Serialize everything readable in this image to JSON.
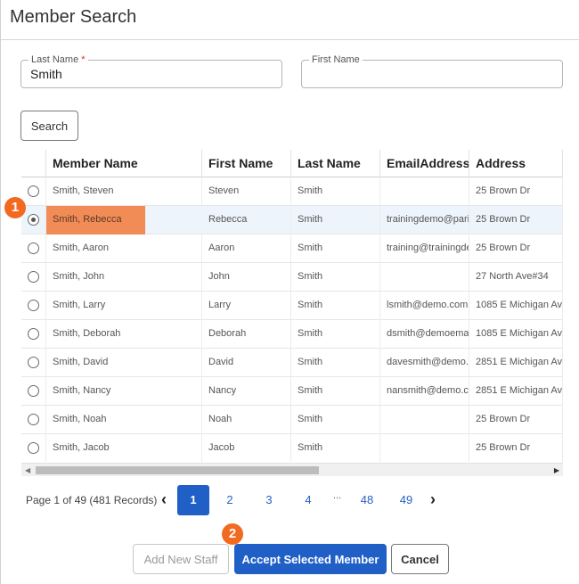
{
  "dialog": {
    "title": "Member Search"
  },
  "form": {
    "last_name": {
      "label": "Last Name",
      "required_mark": "*",
      "value": "Smith"
    },
    "first_name": {
      "label": "First Name",
      "value": ""
    },
    "search_label": "Search"
  },
  "table": {
    "columns": [
      "Member Name",
      "First Name",
      "Last Name",
      "EmailAddress",
      "Address"
    ],
    "selected_index": 1,
    "rows": [
      {
        "member_name": "Smith, Steven",
        "first": "Steven",
        "last": "Smith",
        "email": "",
        "address": "25 Brown Dr"
      },
      {
        "member_name": "Smith, Rebecca",
        "first": "Rebecca",
        "last": "Smith",
        "email": "trainingdemo@paris",
        "address": "25 Brown Dr"
      },
      {
        "member_name": "Smith, Aaron",
        "first": "Aaron",
        "last": "Smith",
        "email": "training@trainingde",
        "address": "25 Brown Dr"
      },
      {
        "member_name": "Smith, John",
        "first": "John",
        "last": "Smith",
        "email": "",
        "address": "27 North Ave#34"
      },
      {
        "member_name": "Smith, Larry",
        "first": "Larry",
        "last": "Smith",
        "email": "lsmith@demo.com",
        "address": "1085 E Michigan Av"
      },
      {
        "member_name": "Smith, Deborah",
        "first": "Deborah",
        "last": "Smith",
        "email": "dsmith@demoemai",
        "address": "1085 E Michigan Av"
      },
      {
        "member_name": "Smith, David",
        "first": "David",
        "last": "Smith",
        "email": "davesmith@demo.c",
        "address": "2851 E Michigan Av"
      },
      {
        "member_name": "Smith, Nancy",
        "first": "Nancy",
        "last": "Smith",
        "email": "nansmith@demo.cc",
        "address": "2851 E Michigan Av"
      },
      {
        "member_name": "Smith, Noah",
        "first": "Noah",
        "last": "Smith",
        "email": "",
        "address": "25 Brown Dr"
      },
      {
        "member_name": "Smith, Jacob",
        "first": "Jacob",
        "last": "Smith",
        "email": "",
        "address": "25 Brown Dr"
      }
    ]
  },
  "pagination": {
    "summary": "Page 1 of 49 (481 Records)",
    "pages": [
      "1",
      "2",
      "3",
      "4",
      "48",
      "49"
    ],
    "ellipsis": "...",
    "current": "1"
  },
  "footer": {
    "add_new_staff": "Add New Staff",
    "accept_selected": "Accept Selected Member",
    "cancel": "Cancel"
  },
  "annotations": {
    "step1": "1",
    "step2": "2",
    "color": "#f26a21"
  },
  "colors": {
    "primary": "#1f5fc6",
    "highlight": "#f28c57",
    "selected_row": "#eef4fb"
  }
}
